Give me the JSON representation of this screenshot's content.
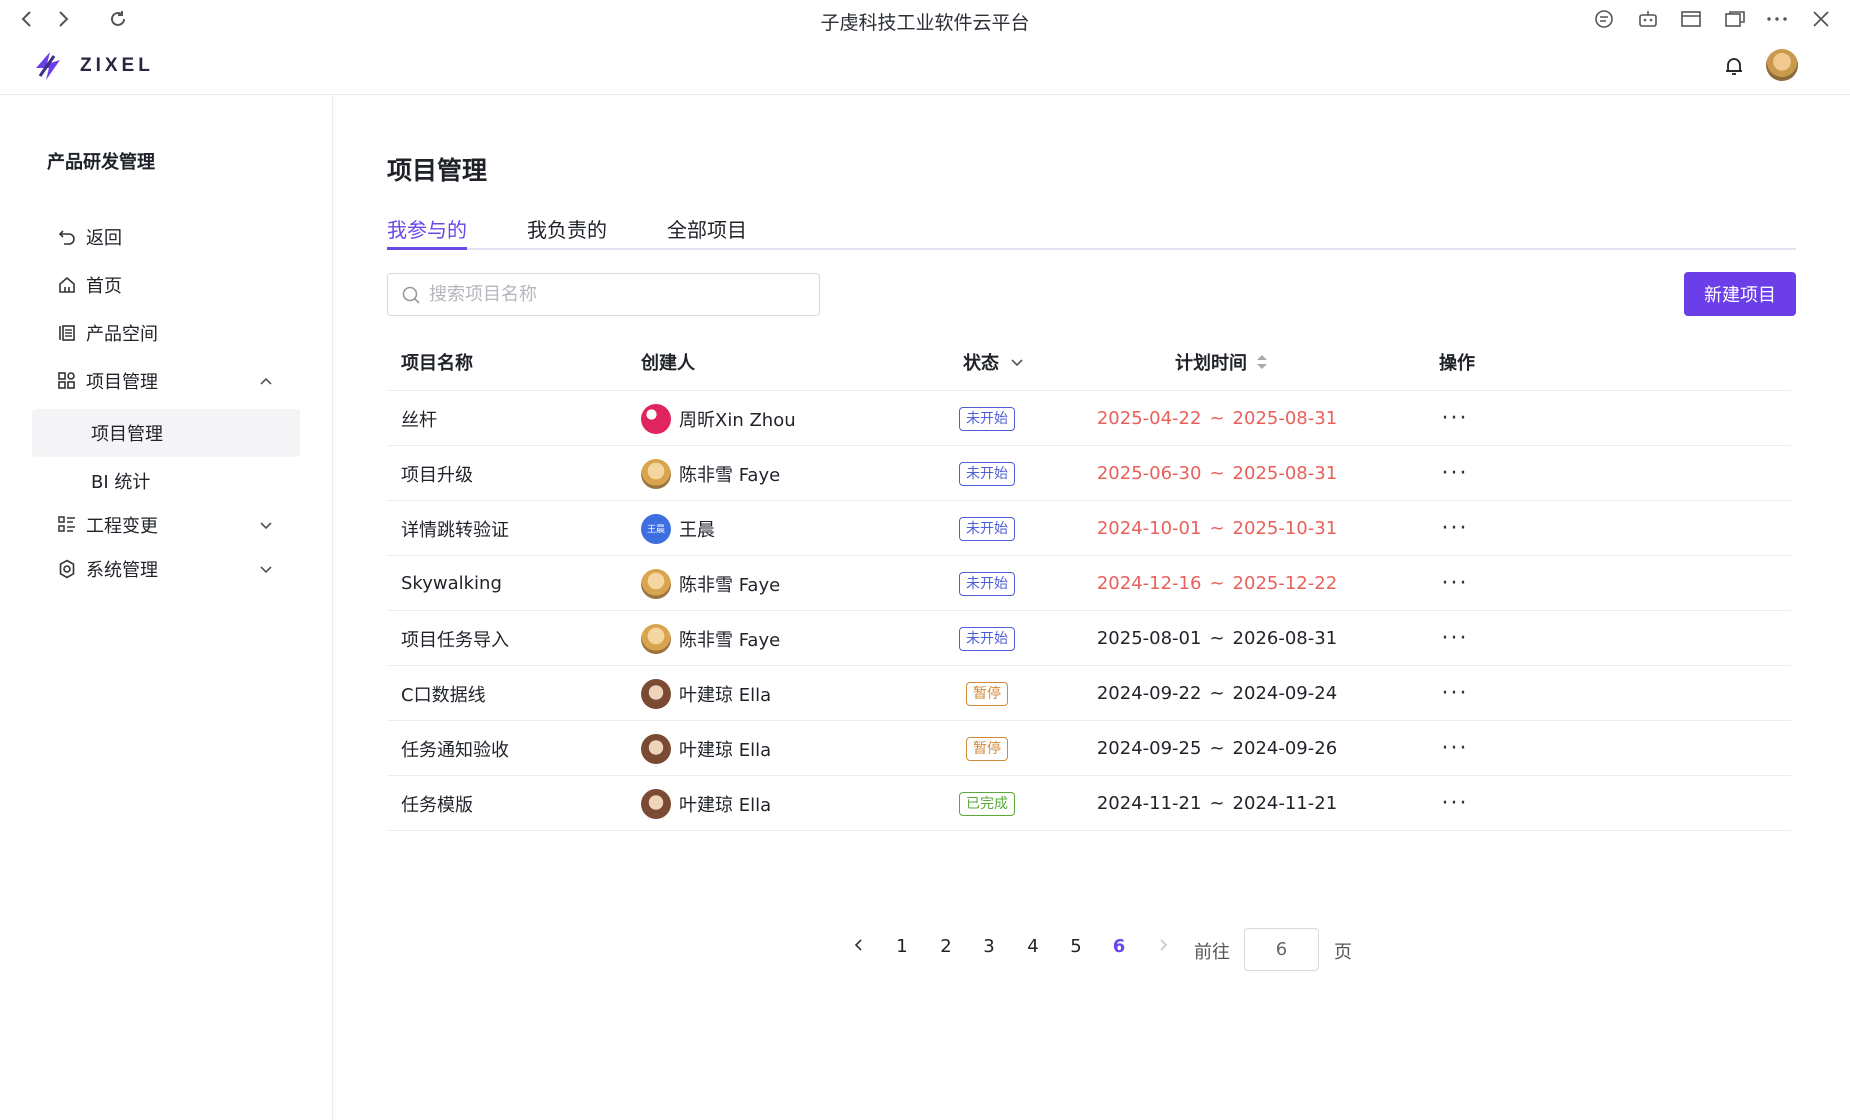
{
  "window": {
    "title": "子虔科技工业软件云平台"
  },
  "brand": {
    "logo_text": "ZIXEL",
    "accent": "#6b3ee8"
  },
  "sidebar": {
    "title": "产品研发管理",
    "items": [
      {
        "label": "返回",
        "icon": "back-icon"
      },
      {
        "label": "首页",
        "icon": "home-icon"
      },
      {
        "label": "产品空间",
        "icon": "product-space-icon"
      },
      {
        "label": "项目管理",
        "icon": "grid-icon",
        "expanded": true
      },
      {
        "label": "项目管理",
        "sub": true,
        "active": true
      },
      {
        "label": "BI 统计",
        "sub": true
      },
      {
        "label": "工程变更",
        "icon": "list-icon",
        "expanded": false
      },
      {
        "label": "系统管理",
        "icon": "gear-icon",
        "expanded": false
      }
    ]
  },
  "main": {
    "title": "项目管理",
    "tabs": [
      {
        "label": "我参与的",
        "active": true
      },
      {
        "label": "我负责的",
        "active": false
      },
      {
        "label": "全部项目",
        "active": false
      }
    ],
    "search_placeholder": "搜索项目名称",
    "new_button": "新建项目"
  },
  "table": {
    "headers": {
      "name": "项目名称",
      "creator": "创建人",
      "status": "状态",
      "time": "计划时间",
      "action": "操作"
    },
    "rows": [
      {
        "name": "丝杆",
        "creator": "周昕Xin Zhou",
        "avatar": "red-pattern",
        "status": "未开始",
        "status_type": "notstarted",
        "start": "2025-04-22",
        "end": "2025-08-31",
        "overdue": true
      },
      {
        "name": "项目升级",
        "creator": "陈非雪 Faye",
        "avatar": "yellow",
        "status": "未开始",
        "status_type": "notstarted",
        "start": "2025-06-30",
        "end": "2025-08-31",
        "overdue": true
      },
      {
        "name": "详情跳转验证",
        "creator": "王晨",
        "avatar": "blue",
        "avatar_text": "王晨",
        "status": "未开始",
        "status_type": "notstarted",
        "start": "2024-10-01",
        "end": "2025-10-31",
        "overdue": true
      },
      {
        "name": "Skywalking",
        "creator": "陈非雪 Faye",
        "avatar": "yellow",
        "status": "未开始",
        "status_type": "notstarted",
        "start": "2024-12-16",
        "end": "2025-12-22",
        "overdue": true
      },
      {
        "name": "项目任务导入",
        "creator": "陈非雪 Faye",
        "avatar": "yellow",
        "status": "未开始",
        "status_type": "notstarted",
        "start": "2025-08-01",
        "end": "2026-08-31",
        "overdue": false
      },
      {
        "name": "C口数据线",
        "creator": "叶建琼 Ella",
        "avatar": "brown",
        "status": "暂停",
        "status_type": "paused",
        "start": "2024-09-22",
        "end": "2024-09-24",
        "overdue": false
      },
      {
        "name": "任务通知验收",
        "creator": "叶建琼 Ella",
        "avatar": "brown",
        "status": "暂停",
        "status_type": "paused",
        "start": "2024-09-25",
        "end": "2024-09-26",
        "overdue": false
      },
      {
        "name": "任务模版",
        "creator": "叶建琼 Ella",
        "avatar": "brown",
        "status": "已完成",
        "status_type": "done",
        "start": "2024-11-21",
        "end": "2024-11-21",
        "overdue": false
      }
    ],
    "date_separator": "~",
    "action_glyph": "···"
  },
  "status_colors": {
    "notstarted": "#4e5fd6",
    "paused": "#d08a3a",
    "done": "#5aa93a",
    "overdue_text": "#e8605a"
  },
  "pagination": {
    "pages": [
      "1",
      "2",
      "3",
      "4",
      "5",
      "6"
    ],
    "current": "6",
    "goto_label": "前往",
    "goto_value": "6",
    "page_suffix": "页"
  }
}
